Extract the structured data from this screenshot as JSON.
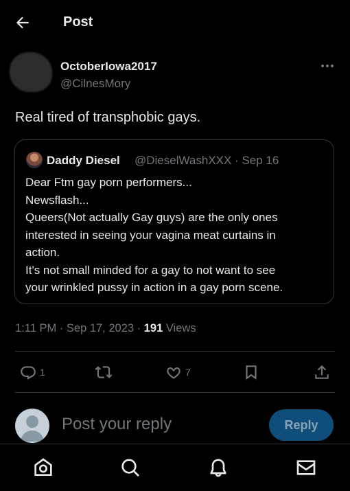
{
  "header": {
    "title": "Post",
    "back_icon": "arrow-left-icon"
  },
  "post": {
    "display_name": "OctoberIowa2017",
    "handle": "@CilnesMory",
    "text": "Real tired of transphobic gays.",
    "more_icon": "more-icon"
  },
  "quote": {
    "display_name": "Daddy Diesel",
    "handle_time": "@DieselWashXXX · Sep 16",
    "lines": [
      "Dear Ftm gay porn performers...",
      "Newsflash...",
      "Queers(Not actually Gay guys) are the only ones",
      "interested in seeing your vagina meat curtains in",
      "action.",
      "It's not small minded for a gay to not want to see",
      "your wrinkled pussy in action in a gay porn scene."
    ]
  },
  "meta": {
    "time_date": "1:11 PM · Sep 17, 2023 · ",
    "views_count": "191",
    "views_label": " Views"
  },
  "actions": {
    "reply_count": "1",
    "repost_count": "",
    "like_count": "7"
  },
  "reply_box": {
    "placeholder": "Post your reply",
    "button_label": "Reply"
  },
  "nav": [
    "home-icon",
    "search-icon",
    "notifications-icon",
    "messages-icon"
  ]
}
